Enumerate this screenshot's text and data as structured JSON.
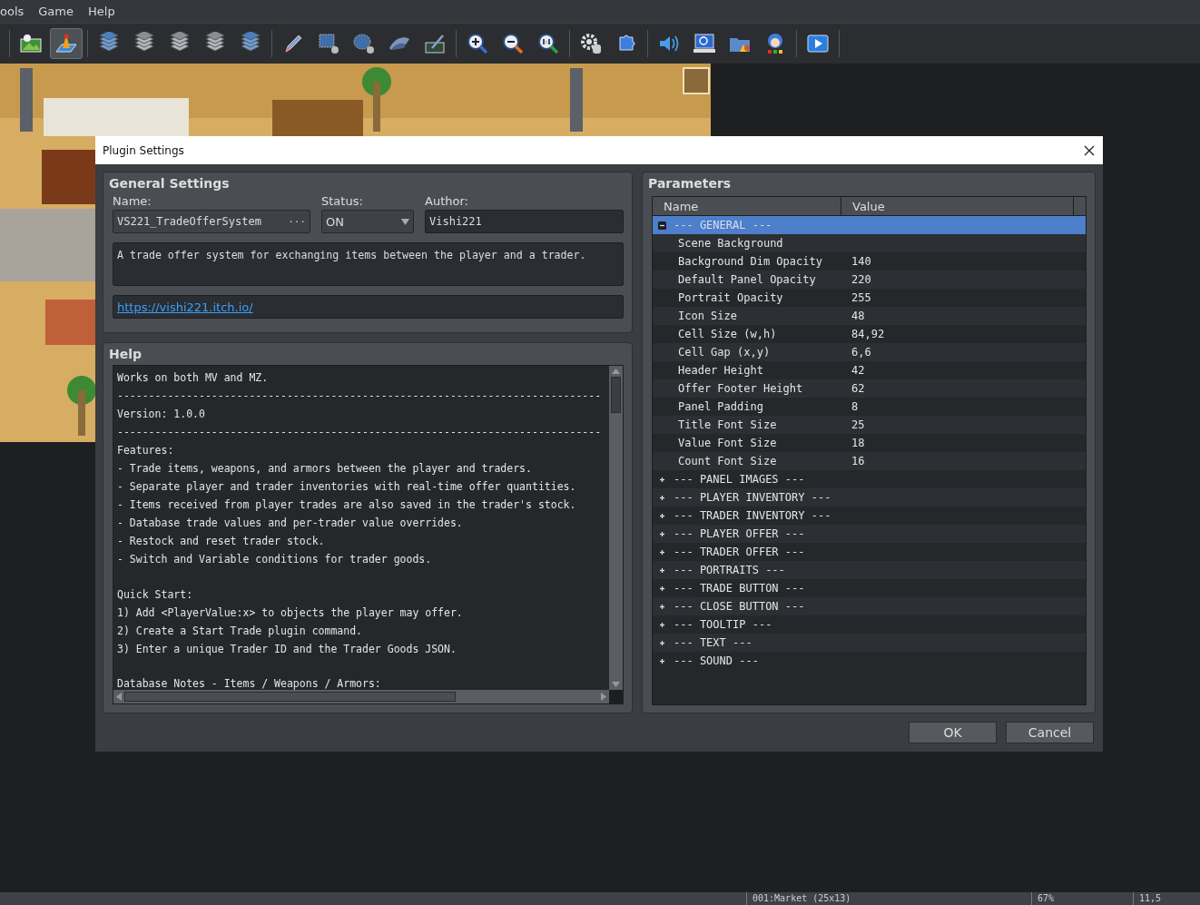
{
  "menu": [
    {
      "label": "ools"
    },
    {
      "label": "Game"
    },
    {
      "label": "Help"
    }
  ],
  "toolbar": [
    [
      {
        "kind": "map",
        "selected": false
      },
      {
        "kind": "event",
        "selected": true
      }
    ],
    [
      {
        "kind": "layer",
        "selected": false
      },
      {
        "kind": "layer",
        "selected": false
      },
      {
        "kind": "layer",
        "selected": false
      },
      {
        "kind": "layer",
        "selected": false
      },
      {
        "kind": "layer",
        "selected": false
      }
    ],
    [
      {
        "kind": "pencil",
        "selected": false
      },
      {
        "kind": "rect",
        "selected": false
      },
      {
        "kind": "ellipse",
        "selected": false
      },
      {
        "kind": "fill",
        "selected": false
      },
      {
        "kind": "shadow",
        "selected": false
      }
    ],
    [
      {
        "kind": "zoom_in",
        "selected": false
      },
      {
        "kind": "zoom_out",
        "selected": false
      },
      {
        "kind": "zoom_reset",
        "selected": false
      }
    ],
    [
      {
        "kind": "database",
        "selected": false
      },
      {
        "kind": "plugin",
        "selected": false
      }
    ],
    [
      {
        "kind": "sound",
        "selected": false
      },
      {
        "kind": "event_search",
        "selected": false
      },
      {
        "kind": "resource",
        "selected": false
      },
      {
        "kind": "character",
        "selected": false
      }
    ],
    [
      {
        "kind": "playtest",
        "selected": false
      }
    ]
  ],
  "map": {
    "kind": "picture"
  },
  "dialog": {
    "title": "Plugin Settings",
    "general": {
      "title": "General Settings",
      "name_label": "Name:",
      "name": "VS221_TradeOfferSystem",
      "browse": "···",
      "status_label": "Status:",
      "status": "ON",
      "author_label": "Author:",
      "author": "Vishi221",
      "description": "A trade offer system for exchanging items between the player and a trader.",
      "url": "https://vishi221.itch.io/"
    },
    "help": {
      "title": "Help",
      "paragraphs": [
        [
          "Works on both MV and MZ.",
          "-----------------------------------------------------------------------------",
          "Version: 1.0.0",
          "-----------------------------------------------------------------------------",
          "Features:",
          "- Trade items, weapons, and armors between the player and traders.",
          "- Separate player and trader inventories with real-time offer quantities.",
          "- Items received from player trades are also saved in the trader's stock.",
          "- Database trade values and per-trader value overrides.",
          "- Restock and reset trader stock.",
          "- Switch and Variable conditions for trader goods."
        ],
        [
          "Quick Start:",
          "1) Add <PlayerValue:x> to objects the player may offer.",
          "2) Create a Start Trade plugin command.",
          "3) Enter a unique Trader ID and the Trader Goods JSON."
        ],
        [
          "Database Notes - Items / Weapons / Armors:"
        ]
      ]
    },
    "parameters": {
      "title": "Parameters",
      "columns": [
        "Name",
        "Value"
      ],
      "groups": [
        {
          "label": "--- GENERAL ---",
          "expanded": true,
          "selected": true,
          "children": [
            {
              "name": "Scene Background"
            },
            {
              "name": "Background Dim Opacity",
              "value": "140"
            },
            {
              "name": "Default Panel Opacity",
              "value": "220"
            },
            {
              "name": "Portrait Opacity",
              "value": "255"
            },
            {
              "name": "Icon Size",
              "value": "48"
            },
            {
              "name": "Cell Size (w,h)",
              "value": "84,92"
            },
            {
              "name": "Cell Gap (x,y)",
              "value": "6,6"
            },
            {
              "name": "Header Height",
              "value": "42"
            },
            {
              "name": "Offer Footer Height",
              "value": "62"
            },
            {
              "name": "Panel Padding",
              "value": "8"
            },
            {
              "name": "Title Font Size",
              "value": "25"
            },
            {
              "name": "Value Font Size",
              "value": "18"
            },
            {
              "name": "Count Font Size",
              "value": "16"
            }
          ]
        },
        {
          "label": "--- PANEL IMAGES ---",
          "expanded": false,
          "selected": false
        },
        {
          "label": "--- PLAYER INVENTORY ---",
          "expanded": false,
          "selected": false
        },
        {
          "label": "--- TRADER INVENTORY ---",
          "expanded": false,
          "selected": false
        },
        {
          "label": "--- PLAYER OFFER ---",
          "expanded": false,
          "selected": false
        },
        {
          "label": "--- TRADER OFFER ---",
          "expanded": false,
          "selected": false
        },
        {
          "label": "--- PORTRAITS ---",
          "expanded": false,
          "selected": false
        },
        {
          "label": "--- TRADE BUTTON ---",
          "expanded": false,
          "selected": false
        },
        {
          "label": "--- CLOSE BUTTON ---",
          "expanded": false,
          "selected": false
        },
        {
          "label": "--- TOOLTIP ---",
          "expanded": false,
          "selected": false
        },
        {
          "label": "--- TEXT ---",
          "expanded": false,
          "selected": false
        },
        {
          "label": "--- SOUND ---",
          "expanded": false,
          "selected": false
        }
      ]
    },
    "buttons": [
      "OK",
      "Cancel"
    ]
  },
  "status_bar": [
    "001:Market (25x13)",
    "67%",
    "11,5"
  ]
}
